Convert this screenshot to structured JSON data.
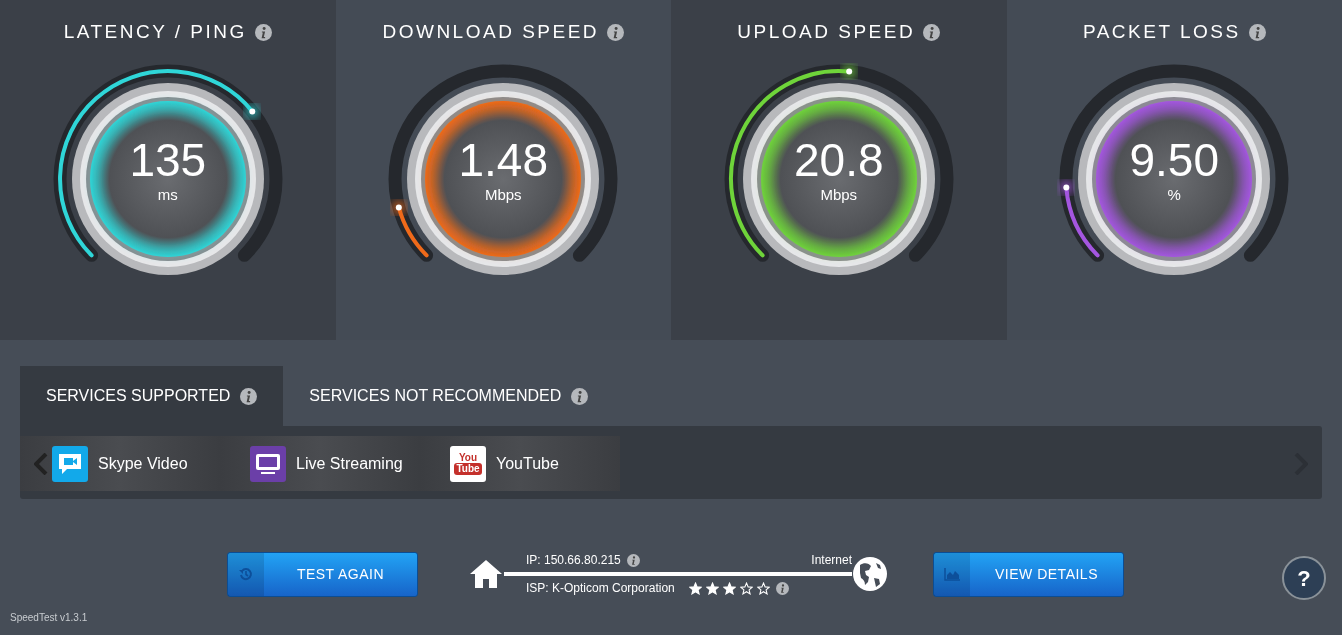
{
  "gauges": [
    {
      "title": "LATENCY / PING",
      "value": "135",
      "unit": "ms",
      "color": "#2fd6d8"
    },
    {
      "title": "DOWNLOAD SPEED",
      "value": "1.48",
      "unit": "Mbps",
      "color": "#f06a1a"
    },
    {
      "title": "UPLOAD SPEED",
      "value": "20.8",
      "unit": "Mbps",
      "color": "#6fd43a"
    },
    {
      "title": "PACKET LOSS",
      "value": "9.50",
      "unit": "%",
      "color": "#a456e0"
    }
  ],
  "tabs": [
    {
      "label": "SERVICES SUPPORTED",
      "selected": true
    },
    {
      "label": "SERVICES NOT RECOMMENDED",
      "selected": false
    }
  ],
  "services": [
    {
      "name": "Skype Video",
      "kind": "video"
    },
    {
      "name": "Live Streaming",
      "kind": "tv"
    },
    {
      "name": "YouTube",
      "kind": "youtube",
      "logo_top": "You",
      "logo_bottom": "Tube"
    }
  ],
  "test_again": "TEST AGAIN",
  "connection": {
    "ip": "IP: 150.66.80.215",
    "internet": "Internet",
    "isp": "ISP: K-Opticom Corporation",
    "stars": 3
  },
  "view_details": "VIEW DETAILS",
  "help": "?",
  "version": "SpeedTest v1.3.1"
}
